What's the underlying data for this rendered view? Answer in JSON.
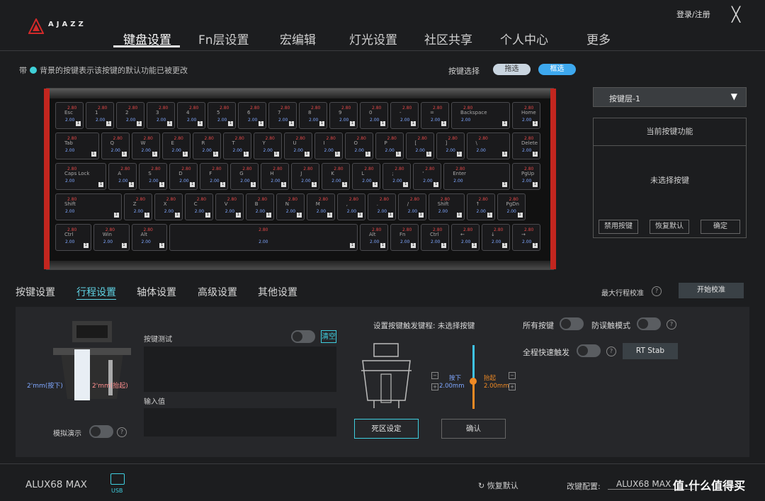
{
  "brand": {
    "logo_text": "AJAZZ"
  },
  "nav": {
    "items": [
      "键盘设置",
      "Fn层设置",
      "宏编辑",
      "灯光设置",
      "社区共享",
      "个人中心",
      "更多"
    ],
    "active": 0
  },
  "header": {
    "login": "登录/注册",
    "close": "╳"
  },
  "legend": {
    "prefix": "带",
    "text": "背景的按键表示该按键的默认功能已被更改"
  },
  "key_select": {
    "label": "按键选择",
    "drag": "拖选",
    "box": "框选"
  },
  "layer": {
    "selected": "按键层-1",
    "arrow": "▼"
  },
  "func_panel": {
    "title": "当前按键功能",
    "empty": "未选择按键",
    "buttons": [
      "禁用按键",
      "恢复默认",
      "确定"
    ]
  },
  "keyboard": {
    "press_value": "2.80",
    "lift_value": "2.00",
    "badge": "1",
    "rows": [
      [
        "Esc",
        "1",
        "2",
        "3",
        "4",
        "5",
        "6",
        "7",
        "8",
        "9",
        "0",
        "-",
        "=",
        "Backspace",
        "Home"
      ],
      [
        "Tab",
        "Q",
        "W",
        "E",
        "R",
        "T",
        "Y",
        "U",
        "I",
        "O",
        "P",
        "[",
        "]",
        "\\",
        "Delete"
      ],
      [
        "Caps Lock",
        "A",
        "S",
        "D",
        "F",
        "G",
        "H",
        "J",
        "K",
        "L",
        ";",
        "'",
        "Enter",
        "PgUp"
      ],
      [
        "Shift",
        "Z",
        "X",
        "C",
        "V",
        "B",
        "N",
        "M",
        ",",
        ".",
        "/",
        "Shift",
        "↑",
        "PgDn"
      ],
      [
        "Ctrl",
        "Win",
        "Alt",
        "",
        "Alt",
        "Fn",
        "Ctrl",
        "←",
        "↓",
        "→"
      ]
    ]
  },
  "tabs": {
    "items": [
      "按键设置",
      "行程设置",
      "轴体设置",
      "高级设置",
      "其他设置"
    ],
    "active": 1
  },
  "calibration": {
    "label": "最大行程校准",
    "button": "开始校准"
  },
  "travel": {
    "down_measure": "2'mm(按下)",
    "up_measure": "2'mm(抬起)",
    "simulate": "模拟演示",
    "key_test": "按键测试",
    "clear": "清空",
    "input_value": "输入值",
    "trigger_title": "设置按键触发键程: 未选择按键",
    "press_label": "按下",
    "press_value": "2.00mm",
    "lift_label": "抬起",
    "lift_value": "2.00mm",
    "deadzone": "死区设定",
    "confirm": "确认",
    "all_keys": "所有按键",
    "anti_mis": "防误触模式",
    "full_rapid": "全程快速触发",
    "rt_stab": "RT Stab"
  },
  "footer": {
    "model": "ALUX68 MAX",
    "usb": "USB",
    "restore": "恢复默认",
    "config_label": "改键配置:",
    "config_value": "ALUX68 MAX",
    "watermark": "值·什么值得买"
  }
}
